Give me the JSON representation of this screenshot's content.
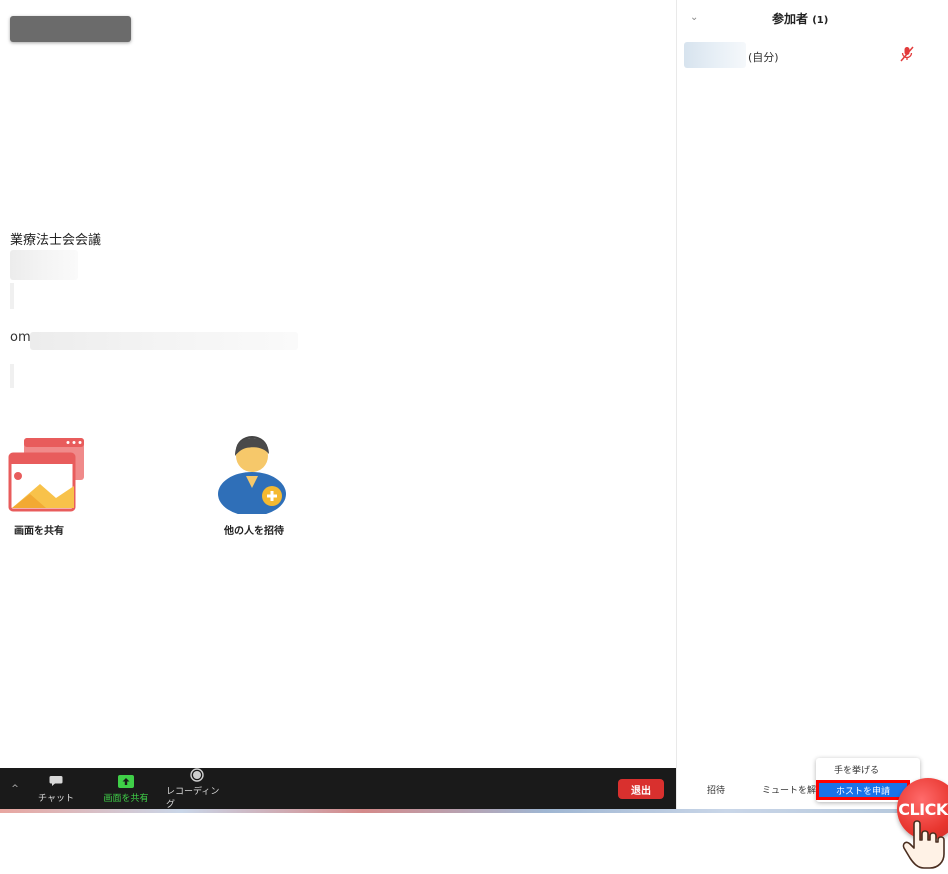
{
  "meeting": {
    "name_fragment": "業療法士会会議",
    "host_email_prefix": "om"
  },
  "actions": {
    "share_screen": "画面を共有",
    "invite_others": "他の人を招待"
  },
  "toolbar": {
    "caret": "^",
    "chat": "チャット",
    "share": "画面を共有",
    "record": "レコーディング",
    "leave": "退出"
  },
  "participants": {
    "title": "参加者",
    "count": "(1)",
    "self_suffix": "(自分)"
  },
  "panel_footer": {
    "invite": "招待",
    "unmute_all": "ミュートを解除",
    "raise_hand": "手を挙げる",
    "claim_host": "ホストを申請"
  },
  "overlay": {
    "click_label": "CLICK"
  },
  "colors": {
    "toolbar_bg": "#1a1a1a",
    "leave_red": "#d9302e",
    "share_green": "#3fcf48",
    "menu_highlight": "#1a73e8",
    "highlight_box": "#ff0000",
    "click_badge": "#e8362f"
  },
  "icons": [
    "share-screen-icon",
    "invite-person-icon",
    "chat-icon",
    "share-screen-arrow-icon",
    "record-icon",
    "collapse-chevron-icon",
    "mic-muted-icon",
    "pointer-hand-icon"
  ]
}
